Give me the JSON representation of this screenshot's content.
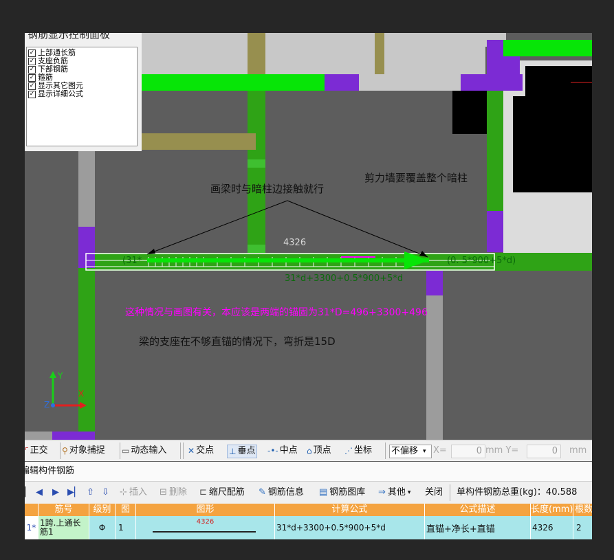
{
  "panel": {
    "title": "钢筋显示控制面板",
    "items": [
      {
        "label": "上部通长筋",
        "checked": true
      },
      {
        "label": "支座负筋",
        "checked": true
      },
      {
        "label": "下部钢筋",
        "checked": true
      },
      {
        "label": "箍筋",
        "checked": true
      },
      {
        "label": "显示其它图元",
        "checked": true
      },
      {
        "label": "显示详细公式",
        "checked": true
      }
    ]
  },
  "canvas": {
    "annotation_contact": "画梁时与暗柱边接触就行",
    "annotation_wall": "剪力墙要覆盖整个暗柱",
    "beam_length": "4326",
    "left_label": "(31*",
    "right_label": "(0. 5*900+5*d)",
    "beam_formula": "31*d+3300+0.5*900+5*d",
    "note_magenta": "这种情况与画图有关，本应该是两端的锚固为31*D=496+3300+496",
    "note_black": "梁的支座在不够直锚的情况下，弯折是15D",
    "axis_y": "Y",
    "axis_x": "X",
    "axis_z": "Z",
    "colors": {
      "beam_green": "#07e507",
      "wall_purple": "#7c2bd4",
      "magenta_text": "#ff00ff",
      "dark_green_text": "#0b6a0b"
    }
  },
  "snapbar": {
    "items": [
      "正交",
      "对象捕捉",
      "动态输入",
      "交点",
      "垂点",
      "中点",
      "顶点",
      "坐标"
    ],
    "offset_select": "不偏移",
    "x_label": "X=",
    "x_value": "0",
    "y_label": "mm Y=",
    "y_value": "0",
    "unit": "mm"
  },
  "editor": {
    "title": "编辑构件钢筋"
  },
  "toolbar": {
    "insert": "插入",
    "delete": "删除",
    "scale": "缩尺配筋",
    "info": "钢筋信息",
    "library": "钢筋图库",
    "other": "其他",
    "close": "关闭",
    "total_weight": "单构件钢筋总重(kg)：40.588"
  },
  "grid": {
    "headers": [
      "筋号",
      "级别",
      "图",
      "图形",
      "计算公式",
      "公式描述",
      "长度(mm)",
      "根数"
    ],
    "rows": [
      {
        "marker": "1*",
        "name": "1跨.上通长筋1",
        "grade": "Φ",
        "fig": "1",
        "shape_len": "4326",
        "formula": "31*d+3300+0.5*900+5*d",
        "desc": "直锚+净长+直锚",
        "length": "4326",
        "count": "2"
      }
    ]
  }
}
